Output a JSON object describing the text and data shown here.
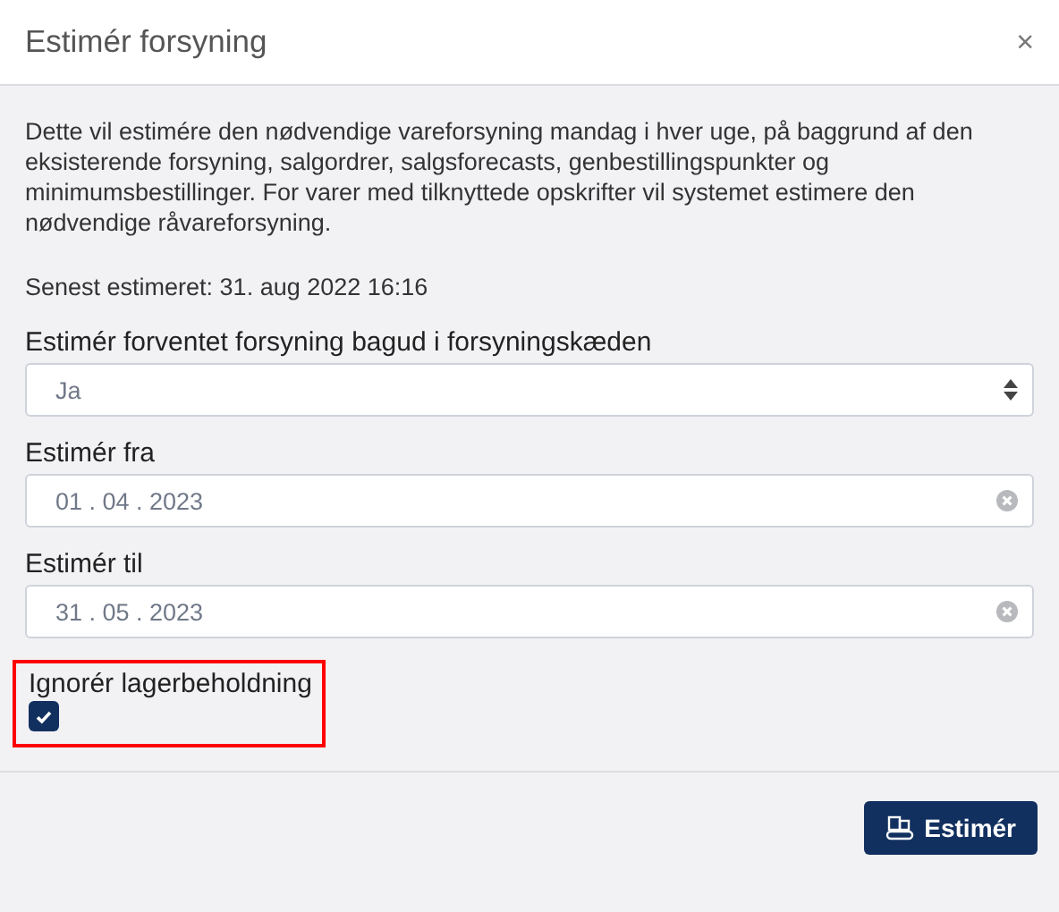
{
  "dialog": {
    "title": "Estimér forsyning",
    "close": "×"
  },
  "description": "Dette vil estimére den nødvendige vareforsyning mandag i hver uge, på baggrund af den eksisterende forsyning, salgordrer, salgsforecasts, genbestillingspunkter og minimumsbestillinger. For varer med tilknyttede opskrifter vil systemet estimere den nødvendige råvareforsyning.",
  "last_estimated": "Senest estimeret: 31. aug 2022 16:16",
  "fields": [
    {
      "kind": "select",
      "label": "Estimér forventet forsyning bagud i forsyningskæden",
      "value": "Ja"
    },
    {
      "kind": "date",
      "label": "Estimér fra",
      "value": "01 . 04 . 2023"
    },
    {
      "kind": "date",
      "label": "Estimér til",
      "value": "31 . 05 . 2023"
    },
    {
      "kind": "checkbox",
      "label": "Ignorér lagerbeholdning",
      "checked": true,
      "highlighted": true
    }
  ],
  "buttons": [
    {
      "label": "Estimér"
    }
  ]
}
